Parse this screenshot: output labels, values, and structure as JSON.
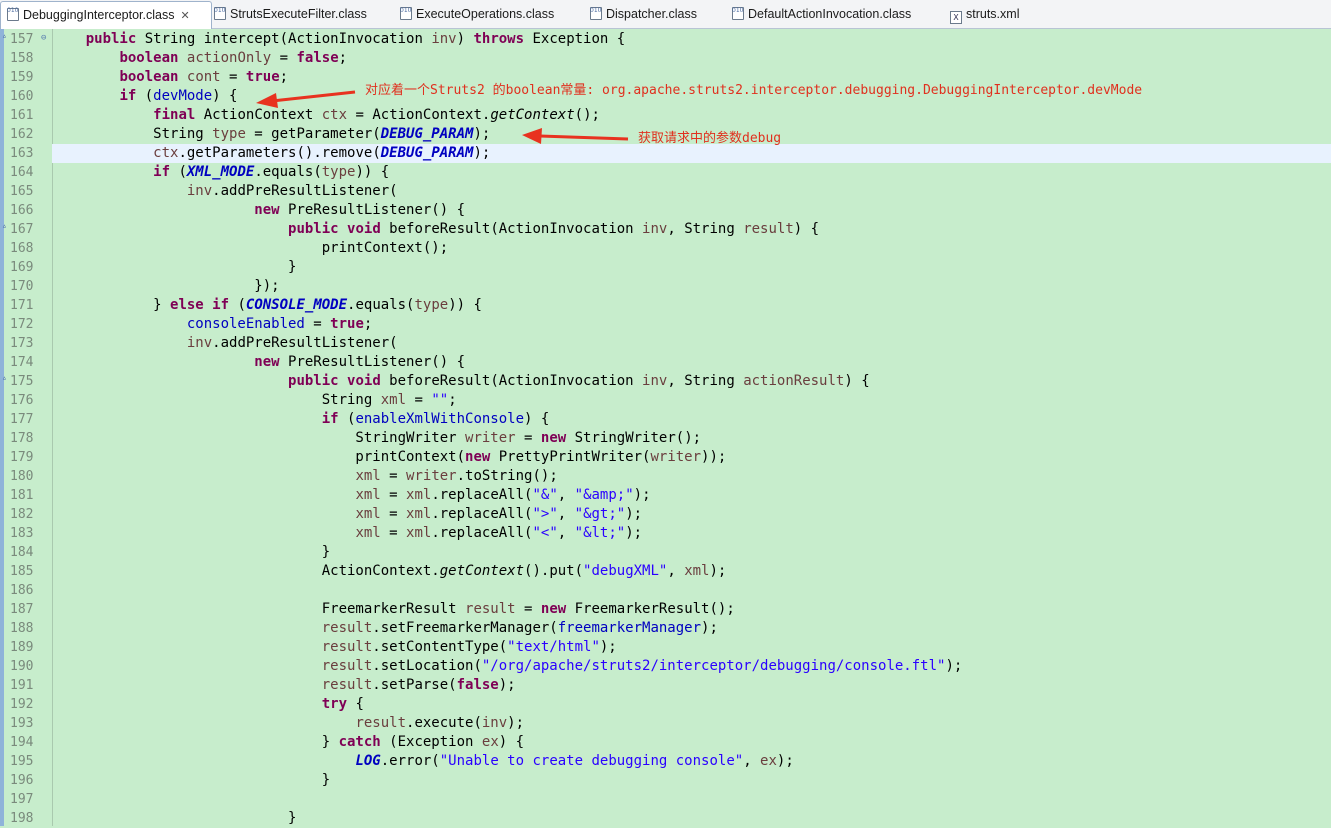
{
  "tabs": [
    {
      "label": "DebuggingInterceptor.class",
      "icon": "class-file-icon",
      "active": true,
      "closable": true
    },
    {
      "label": "StrutsExecuteFilter.class",
      "icon": "class-file-icon"
    },
    {
      "label": "ExecuteOperations.class",
      "icon": "class-file-icon"
    },
    {
      "label": "Dispatcher.class",
      "icon": "class-file-icon"
    },
    {
      "label": "DefaultActionInvocation.class",
      "icon": "class-file-icon"
    },
    {
      "label": "struts.xml",
      "icon": "xml-file-icon"
    }
  ],
  "editor": {
    "line_numbers": [
      "157",
      "158",
      "159",
      "160",
      "161",
      "162",
      "163",
      "164",
      "165",
      "166",
      "167",
      "168",
      "169",
      "170",
      "171",
      "172",
      "173",
      "174",
      "175",
      "176",
      "177",
      "178",
      "179",
      "180",
      "181",
      "182",
      "183",
      "184",
      "185",
      "186",
      "187",
      "188",
      "189",
      "190",
      "191",
      "192",
      "193",
      "194",
      "195",
      "196",
      "197",
      "198"
    ],
    "current_line": "163",
    "lines": [
      [
        [
          "    ",
          "p"
        ],
        [
          "public",
          "k"
        ],
        [
          " String intercept(ActionInvocation ",
          "p"
        ],
        [
          "inv",
          "l"
        ],
        [
          ") ",
          "p"
        ],
        [
          "throws",
          "k"
        ],
        [
          " Exception {",
          "p"
        ]
      ],
      [
        [
          "        ",
          "p"
        ],
        [
          "boolean",
          "k"
        ],
        [
          " ",
          "p"
        ],
        [
          "actionOnly",
          "l"
        ],
        [
          " = ",
          "p"
        ],
        [
          "false",
          "k"
        ],
        [
          ";",
          "p"
        ]
      ],
      [
        [
          "        ",
          "p"
        ],
        [
          "boolean",
          "k"
        ],
        [
          " ",
          "p"
        ],
        [
          "cont",
          "l"
        ],
        [
          " = ",
          "p"
        ],
        [
          "true",
          "k"
        ],
        [
          ";",
          "p"
        ]
      ],
      [
        [
          "        ",
          "p"
        ],
        [
          "if",
          "k"
        ],
        [
          " (",
          "p"
        ],
        [
          "devMode",
          "f"
        ],
        [
          ") {",
          "p"
        ]
      ],
      [
        [
          "            ",
          "p"
        ],
        [
          "final",
          "k"
        ],
        [
          " ActionContext ",
          "p"
        ],
        [
          "ctx",
          "l"
        ],
        [
          " = ActionContext.",
          "p"
        ],
        [
          "getContext",
          "i"
        ],
        [
          "();",
          "p"
        ]
      ],
      [
        [
          "            String ",
          "p"
        ],
        [
          "type",
          "l"
        ],
        [
          " = getParameter(",
          "p"
        ],
        [
          "DEBUG_PARAM",
          "s"
        ],
        [
          ");",
          "p"
        ]
      ],
      [
        [
          "            ",
          "p"
        ],
        [
          "ctx",
          "l"
        ],
        [
          ".getParameters().remove(",
          "p"
        ],
        [
          "DEBUG_PARAM",
          "s"
        ],
        [
          ");",
          "p"
        ]
      ],
      [
        [
          "            ",
          "p"
        ],
        [
          "if",
          "k"
        ],
        [
          " (",
          "p"
        ],
        [
          "XML_MODE",
          "s"
        ],
        [
          ".equals(",
          "p"
        ],
        [
          "type",
          "l"
        ],
        [
          ")) {",
          "p"
        ]
      ],
      [
        [
          "                ",
          "p"
        ],
        [
          "inv",
          "l"
        ],
        [
          ".addPreResultListener(",
          "p"
        ]
      ],
      [
        [
          "                        ",
          "p"
        ],
        [
          "new",
          "k"
        ],
        [
          " PreResultListener() {",
          "p"
        ]
      ],
      [
        [
          "                            ",
          "p"
        ],
        [
          "public",
          "k"
        ],
        [
          " ",
          "p"
        ],
        [
          "void",
          "k"
        ],
        [
          " beforeResult(ActionInvocation ",
          "p"
        ],
        [
          "inv",
          "l"
        ],
        [
          ", String ",
          "p"
        ],
        [
          "result",
          "l"
        ],
        [
          ") {",
          "p"
        ]
      ],
      [
        [
          "                                printContext();",
          "p"
        ]
      ],
      [
        [
          "                            }",
          "p"
        ]
      ],
      [
        [
          "                        });",
          "p"
        ]
      ],
      [
        [
          "            } ",
          "p"
        ],
        [
          "else",
          "k"
        ],
        [
          " ",
          "p"
        ],
        [
          "if",
          "k"
        ],
        [
          " (",
          "p"
        ],
        [
          "CONSOLE_MODE",
          "s"
        ],
        [
          ".equals(",
          "p"
        ],
        [
          "type",
          "l"
        ],
        [
          ")) {",
          "p"
        ]
      ],
      [
        [
          "                ",
          "p"
        ],
        [
          "consoleEnabled",
          "f"
        ],
        [
          " = ",
          "p"
        ],
        [
          "true",
          "k"
        ],
        [
          ";",
          "p"
        ]
      ],
      [
        [
          "                ",
          "p"
        ],
        [
          "inv",
          "l"
        ],
        [
          ".addPreResultListener(",
          "p"
        ]
      ],
      [
        [
          "                        ",
          "p"
        ],
        [
          "new",
          "k"
        ],
        [
          " PreResultListener() {",
          "p"
        ]
      ],
      [
        [
          "                            ",
          "p"
        ],
        [
          "public",
          "k"
        ],
        [
          " ",
          "p"
        ],
        [
          "void",
          "k"
        ],
        [
          " beforeResult(ActionInvocation ",
          "p"
        ],
        [
          "inv",
          "l"
        ],
        [
          ", String ",
          "p"
        ],
        [
          "actionResult",
          "l"
        ],
        [
          ") {",
          "p"
        ]
      ],
      [
        [
          "                                String ",
          "p"
        ],
        [
          "xml",
          "l"
        ],
        [
          " = ",
          "p"
        ],
        [
          "\"\"",
          "t"
        ],
        [
          ";",
          "p"
        ]
      ],
      [
        [
          "                                ",
          "p"
        ],
        [
          "if",
          "k"
        ],
        [
          " (",
          "p"
        ],
        [
          "enableXmlWithConsole",
          "f"
        ],
        [
          ") {",
          "p"
        ]
      ],
      [
        [
          "                                    StringWriter ",
          "p"
        ],
        [
          "writer",
          "l"
        ],
        [
          " = ",
          "p"
        ],
        [
          "new",
          "k"
        ],
        [
          " StringWriter();",
          "p"
        ]
      ],
      [
        [
          "                                    printContext(",
          "p"
        ],
        [
          "new",
          "k"
        ],
        [
          " PrettyPrintWriter(",
          "p"
        ],
        [
          "writer",
          "l"
        ],
        [
          "));",
          "p"
        ]
      ],
      [
        [
          "                                    ",
          "p"
        ],
        [
          "xml",
          "l"
        ],
        [
          " = ",
          "p"
        ],
        [
          "writer",
          "l"
        ],
        [
          ".toString();",
          "p"
        ]
      ],
      [
        [
          "                                    ",
          "p"
        ],
        [
          "xml",
          "l"
        ],
        [
          " = ",
          "p"
        ],
        [
          "xml",
          "l"
        ],
        [
          ".replaceAll(",
          "p"
        ],
        [
          "\"&\"",
          "t"
        ],
        [
          ", ",
          "p"
        ],
        [
          "\"&amp;\"",
          "t"
        ],
        [
          ");",
          "p"
        ]
      ],
      [
        [
          "                                    ",
          "p"
        ],
        [
          "xml",
          "l"
        ],
        [
          " = ",
          "p"
        ],
        [
          "xml",
          "l"
        ],
        [
          ".replaceAll(",
          "p"
        ],
        [
          "\">\"",
          "t"
        ],
        [
          ", ",
          "p"
        ],
        [
          "\"&gt;\"",
          "t"
        ],
        [
          ");",
          "p"
        ]
      ],
      [
        [
          "                                    ",
          "p"
        ],
        [
          "xml",
          "l"
        ],
        [
          " = ",
          "p"
        ],
        [
          "xml",
          "l"
        ],
        [
          ".replaceAll(",
          "p"
        ],
        [
          "\"<\"",
          "t"
        ],
        [
          ", ",
          "p"
        ],
        [
          "\"&lt;\"",
          "t"
        ],
        [
          ");",
          "p"
        ]
      ],
      [
        [
          "                                }",
          "p"
        ]
      ],
      [
        [
          "                                ActionContext.",
          "p"
        ],
        [
          "getContext",
          "i"
        ],
        [
          "().put(",
          "p"
        ],
        [
          "\"debugXML\"",
          "t"
        ],
        [
          ", ",
          "p"
        ],
        [
          "xml",
          "l"
        ],
        [
          ");",
          "p"
        ]
      ],
      [
        [
          "",
          "p"
        ]
      ],
      [
        [
          "                                FreemarkerResult ",
          "p"
        ],
        [
          "result",
          "l"
        ],
        [
          " = ",
          "p"
        ],
        [
          "new",
          "k"
        ],
        [
          " FreemarkerResult();",
          "p"
        ]
      ],
      [
        [
          "                                ",
          "p"
        ],
        [
          "result",
          "l"
        ],
        [
          ".setFreemarkerManager(",
          "p"
        ],
        [
          "freemarkerManager",
          "f"
        ],
        [
          ");",
          "p"
        ]
      ],
      [
        [
          "                                ",
          "p"
        ],
        [
          "result",
          "l"
        ],
        [
          ".setContentType(",
          "p"
        ],
        [
          "\"text/html\"",
          "t"
        ],
        [
          ");",
          "p"
        ]
      ],
      [
        [
          "                                ",
          "p"
        ],
        [
          "result",
          "l"
        ],
        [
          ".setLocation(",
          "p"
        ],
        [
          "\"/org/apache/struts2/interceptor/debugging/console.ftl\"",
          "t"
        ],
        [
          ");",
          "p"
        ]
      ],
      [
        [
          "                                ",
          "p"
        ],
        [
          "result",
          "l"
        ],
        [
          ".setParse(",
          "p"
        ],
        [
          "false",
          "k"
        ],
        [
          ");",
          "p"
        ]
      ],
      [
        [
          "                                ",
          "p"
        ],
        [
          "try",
          "k"
        ],
        [
          " {",
          "p"
        ]
      ],
      [
        [
          "                                    ",
          "p"
        ],
        [
          "result",
          "l"
        ],
        [
          ".execute(",
          "p"
        ],
        [
          "inv",
          "l"
        ],
        [
          ");",
          "p"
        ]
      ],
      [
        [
          "                                } ",
          "p"
        ],
        [
          "catch",
          "k"
        ],
        [
          " (Exception ",
          "p"
        ],
        [
          "ex",
          "l"
        ],
        [
          ") {",
          "p"
        ]
      ],
      [
        [
          "                                    ",
          "p"
        ],
        [
          "LOG",
          "s"
        ],
        [
          ".error(",
          "p"
        ],
        [
          "\"Unable to create debugging console\"",
          "t"
        ],
        [
          ", ",
          "p"
        ],
        [
          "ex",
          "l"
        ],
        [
          ");",
          "p"
        ]
      ],
      [
        [
          "                                }",
          "p"
        ]
      ],
      [
        [
          "",
          "p"
        ]
      ],
      [
        [
          "                            }",
          "p"
        ]
      ]
    ]
  },
  "annotations": {
    "devmode_note": "对应着一个Struts2 的boolean常量: org.apache.struts2.interceptor.debugging.DebuggingInterceptor.devMode",
    "debug_param_note": "获取请求中的参数debug"
  },
  "colors": {
    "background": "#c7edcc",
    "keyword": "#7f0055",
    "field": "#0000c0",
    "string": "#2a00ff",
    "local": "#6a3e3e",
    "annotation": "#e0301e",
    "current_line": "#e8f2fe"
  }
}
